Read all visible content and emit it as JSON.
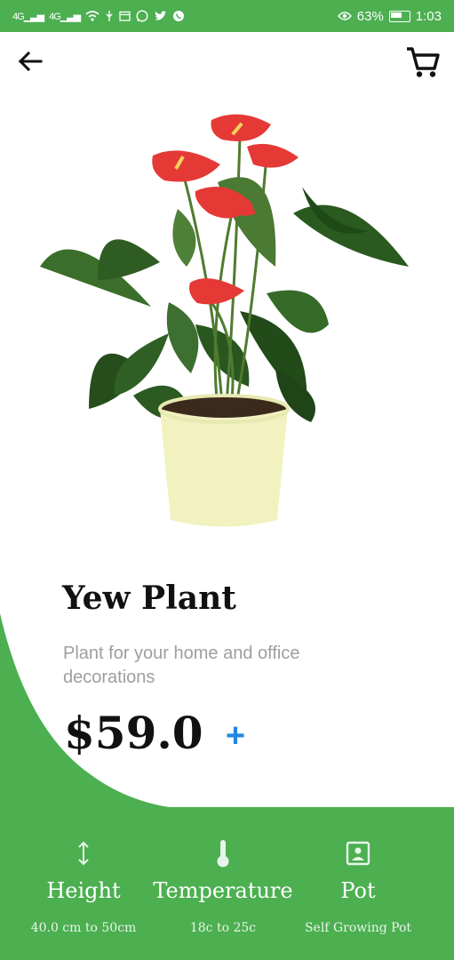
{
  "status_bar": {
    "signal_1": "4G",
    "signal_2": "4G",
    "battery": "63%",
    "time": "1:03",
    "icons": [
      "wifi-icon",
      "usb-icon",
      "calendar-icon",
      "whatsapp-icon",
      "twitter-icon",
      "whatsapp-icon",
      "eye-icon",
      "battery-icon"
    ]
  },
  "header": {
    "back_icon": "arrow-back-icon",
    "cart_icon": "shopping-cart-icon"
  },
  "product": {
    "name": "Yew Plant",
    "description": "Plant for your home and office decorations",
    "price": "$59.0",
    "add_label": "+"
  },
  "attributes": [
    {
      "icon": "height-icon",
      "label": "Height",
      "value": "40.0 cm to 50cm"
    },
    {
      "icon": "thermometer-icon",
      "label": "Temperature",
      "value": "18c to 25c"
    },
    {
      "icon": "pot-icon",
      "label": "Pot",
      "value": "Self Growing Pot"
    }
  ],
  "colors": {
    "accent_green": "#4caf50",
    "add_blue": "#1e88e5",
    "flower_red": "#e53935"
  }
}
